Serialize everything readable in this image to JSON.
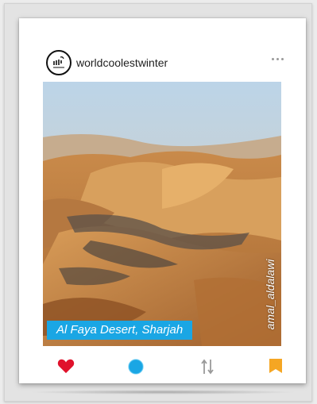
{
  "post": {
    "username": "worldcoolestwinter",
    "avatar_text": "The Emirates",
    "caption": "Al Faya Desert, Sharjah",
    "photo_credit": "amal_aldalawi"
  },
  "icons": {
    "avatar": "emirates-logo-icon",
    "more": "more-dots-icon",
    "like": "heart-icon",
    "comment": "comment-circle-icon",
    "share": "share-arrows-icon",
    "save": "bookmark-icon"
  },
  "colors": {
    "like": "#e0112b",
    "comment": "#1aa6e4",
    "save": "#f5a623",
    "caption_bg": "#1aa6e4"
  }
}
